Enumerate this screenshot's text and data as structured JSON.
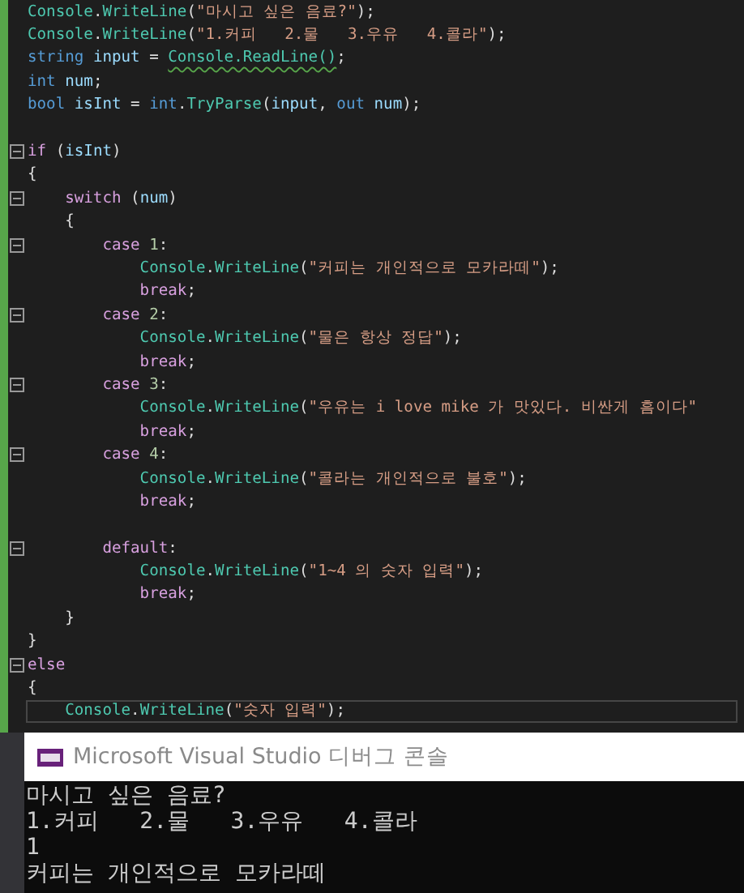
{
  "editor": {
    "lines": [
      {
        "tokens": [
          {
            "text": "Console",
            "kind": "type"
          },
          {
            "text": ".",
            "kind": "plain"
          },
          {
            "text": "WriteLine",
            "kind": "type"
          },
          {
            "text": "(",
            "kind": "plain"
          },
          {
            "text": "\"마시고 싶은 음료?\"",
            "kind": "string"
          },
          {
            "text": ");",
            "kind": "plain"
          }
        ]
      },
      {
        "tokens": [
          {
            "text": "Console",
            "kind": "type"
          },
          {
            "text": ".",
            "kind": "plain"
          },
          {
            "text": "WriteLine",
            "kind": "type"
          },
          {
            "text": "(",
            "kind": "plain"
          },
          {
            "text": "\"1.커피   2.물   3.우유   4.콜라\"",
            "kind": "string"
          },
          {
            "text": ");",
            "kind": "plain"
          }
        ]
      },
      {
        "tokens": [
          {
            "text": "string ",
            "kind": "keyword"
          },
          {
            "text": "input",
            "kind": "variable"
          },
          {
            "text": " = ",
            "kind": "plain"
          },
          {
            "text": "Console.ReadLine()",
            "kind": "type",
            "warning": true
          },
          {
            "text": ";",
            "kind": "plain"
          }
        ]
      },
      {
        "tokens": [
          {
            "text": "int ",
            "kind": "keyword"
          },
          {
            "text": "num",
            "kind": "variable"
          },
          {
            "text": ";",
            "kind": "plain"
          }
        ]
      },
      {
        "tokens": [
          {
            "text": "bool ",
            "kind": "keyword"
          },
          {
            "text": "isInt",
            "kind": "variable"
          },
          {
            "text": " = ",
            "kind": "plain"
          },
          {
            "text": "int",
            "kind": "keyword"
          },
          {
            "text": ".",
            "kind": "plain"
          },
          {
            "text": "TryParse",
            "kind": "type"
          },
          {
            "text": "(",
            "kind": "plain"
          },
          {
            "text": "input",
            "kind": "variable"
          },
          {
            "text": ", ",
            "kind": "plain"
          },
          {
            "text": "out ",
            "kind": "keyword"
          },
          {
            "text": "num",
            "kind": "variable"
          },
          {
            "text": ");",
            "kind": "plain"
          }
        ]
      },
      {
        "blank": true
      },
      {
        "foldable": true,
        "tokens": [
          {
            "text": "if",
            "kind": "control"
          },
          {
            "text": " (",
            "kind": "plain"
          },
          {
            "text": "isInt",
            "kind": "variable"
          },
          {
            "text": ")",
            "kind": "plain"
          }
        ]
      },
      {
        "tokens": [
          {
            "text": "{",
            "kind": "plain"
          }
        ]
      },
      {
        "foldable": true,
        "tokens": [
          {
            "text": "    switch",
            "kind": "control"
          },
          {
            "text": " (",
            "kind": "plain"
          },
          {
            "text": "num",
            "kind": "variable"
          },
          {
            "text": ")",
            "kind": "plain"
          }
        ]
      },
      {
        "tokens": [
          {
            "text": "    {",
            "kind": "plain"
          }
        ]
      },
      {
        "foldable": true,
        "tokens": [
          {
            "text": "        case ",
            "kind": "control"
          },
          {
            "text": "1",
            "kind": "number"
          },
          {
            "text": ":",
            "kind": "plain"
          }
        ]
      },
      {
        "tokens": [
          {
            "text": "            Console",
            "kind": "type"
          },
          {
            "text": ".",
            "kind": "plain"
          },
          {
            "text": "WriteLine",
            "kind": "type"
          },
          {
            "text": "(",
            "kind": "plain"
          },
          {
            "text": "\"커피는 개인적으로 모카라떼\"",
            "kind": "string"
          },
          {
            "text": ");",
            "kind": "plain"
          }
        ]
      },
      {
        "tokens": [
          {
            "text": "            break",
            "kind": "control"
          },
          {
            "text": ";",
            "kind": "plain"
          }
        ]
      },
      {
        "foldable": true,
        "tokens": [
          {
            "text": "        case ",
            "kind": "control"
          },
          {
            "text": "2",
            "kind": "number"
          },
          {
            "text": ":",
            "kind": "plain"
          }
        ]
      },
      {
        "tokens": [
          {
            "text": "            Console",
            "kind": "type"
          },
          {
            "text": ".",
            "kind": "plain"
          },
          {
            "text": "WriteLine",
            "kind": "type"
          },
          {
            "text": "(",
            "kind": "plain"
          },
          {
            "text": "\"물은 항상 정답\"",
            "kind": "string"
          },
          {
            "text": ");",
            "kind": "plain"
          }
        ]
      },
      {
        "tokens": [
          {
            "text": "            break",
            "kind": "control"
          },
          {
            "text": ";",
            "kind": "plain"
          }
        ]
      },
      {
        "foldable": true,
        "tokens": [
          {
            "text": "        case ",
            "kind": "control"
          },
          {
            "text": "3",
            "kind": "number"
          },
          {
            "text": ":",
            "kind": "plain"
          }
        ]
      },
      {
        "tokens": [
          {
            "text": "            Console",
            "kind": "type"
          },
          {
            "text": ".",
            "kind": "plain"
          },
          {
            "text": "WriteLine",
            "kind": "type"
          },
          {
            "text": "(",
            "kind": "plain"
          },
          {
            "text": "\"우유는 i love mike 가 맛있다. 비싼게 흠이다\"",
            "kind": "string"
          }
        ]
      },
      {
        "tokens": [
          {
            "text": "            break",
            "kind": "control"
          },
          {
            "text": ";",
            "kind": "plain"
          }
        ]
      },
      {
        "foldable": true,
        "tokens": [
          {
            "text": "        case ",
            "kind": "control"
          },
          {
            "text": "4",
            "kind": "number"
          },
          {
            "text": ":",
            "kind": "plain"
          }
        ]
      },
      {
        "tokens": [
          {
            "text": "            Console",
            "kind": "type"
          },
          {
            "text": ".",
            "kind": "plain"
          },
          {
            "text": "WriteLine",
            "kind": "type"
          },
          {
            "text": "(",
            "kind": "plain"
          },
          {
            "text": "\"콜라는 개인적으로 불호\"",
            "kind": "string"
          },
          {
            "text": ");",
            "kind": "plain"
          }
        ]
      },
      {
        "tokens": [
          {
            "text": "            break",
            "kind": "control"
          },
          {
            "text": ";",
            "kind": "plain"
          }
        ]
      },
      {
        "blank": true
      },
      {
        "foldable": true,
        "tokens": [
          {
            "text": "        default",
            "kind": "control"
          },
          {
            "text": ":",
            "kind": "plain"
          }
        ]
      },
      {
        "tokens": [
          {
            "text": "            Console",
            "kind": "type"
          },
          {
            "text": ".",
            "kind": "plain"
          },
          {
            "text": "WriteLine",
            "kind": "type"
          },
          {
            "text": "(",
            "kind": "plain"
          },
          {
            "text": "\"1~4 의 숫자 입력\"",
            "kind": "string"
          },
          {
            "text": ");",
            "kind": "plain"
          }
        ]
      },
      {
        "tokens": [
          {
            "text": "            break",
            "kind": "control"
          },
          {
            "text": ";",
            "kind": "plain"
          }
        ]
      },
      {
        "tokens": [
          {
            "text": "    }",
            "kind": "plain"
          }
        ]
      },
      {
        "tokens": [
          {
            "text": "}",
            "kind": "plain"
          }
        ]
      },
      {
        "foldable": true,
        "tokens": [
          {
            "text": "else",
            "kind": "control"
          }
        ]
      },
      {
        "tokens": [
          {
            "text": "{",
            "kind": "plain"
          }
        ]
      },
      {
        "current": true,
        "tokens": [
          {
            "text": "    Console",
            "kind": "type"
          },
          {
            "text": ".",
            "kind": "plain"
          },
          {
            "text": "WriteLine",
            "kind": "type"
          },
          {
            "text": "(",
            "kind": "plain"
          },
          {
            "text": "\"숫자 입력\"",
            "kind": "string"
          },
          {
            "text": ");",
            "kind": "plain"
          }
        ]
      }
    ]
  },
  "console": {
    "title": "Microsoft Visual Studio 디버그 콘솔",
    "output": [
      "마시고 싶은 음료?",
      "1.커피   2.물   3.우유   4.콜라",
      "1",
      "커피는 개인적으로 모카라떼"
    ]
  }
}
